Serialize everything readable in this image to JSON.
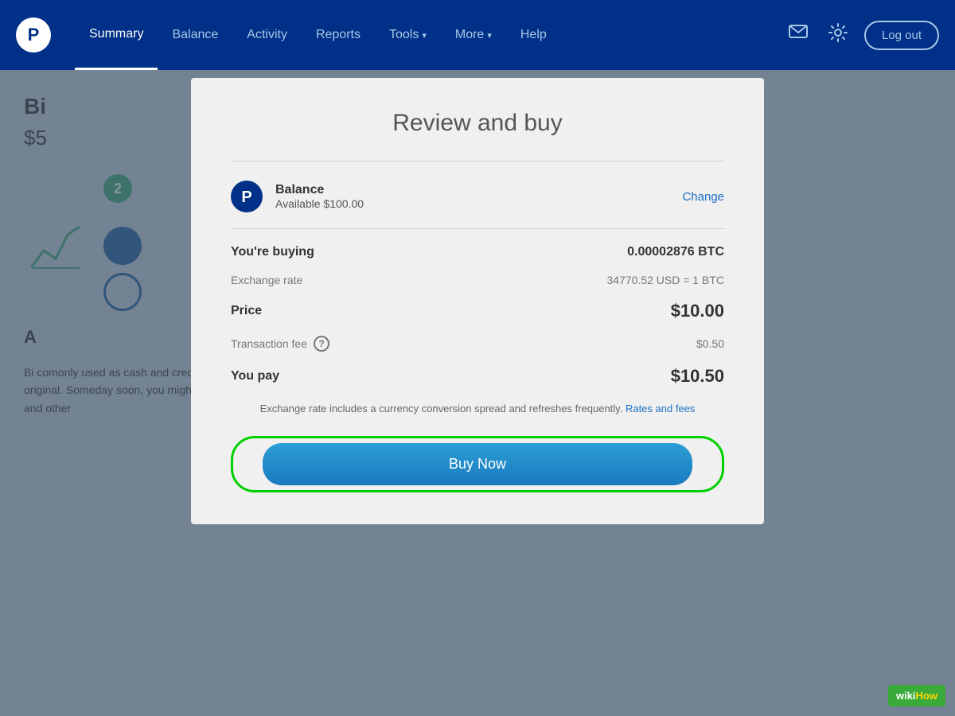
{
  "navbar": {
    "logo_alt": "PayPal",
    "links": [
      {
        "label": "Summary",
        "active": true
      },
      {
        "label": "Balance",
        "active": false
      },
      {
        "label": "Activity",
        "active": false
      },
      {
        "label": "Reports",
        "active": false
      },
      {
        "label": "Tools",
        "active": false,
        "has_chevron": true
      },
      {
        "label": "More",
        "active": false,
        "has_chevron": true
      },
      {
        "label": "Help",
        "active": false
      }
    ],
    "message_icon": "💬",
    "settings_icon": "⚙",
    "logout_label": "Log out"
  },
  "background": {
    "title": "Bi",
    "price": "$5",
    "step_number": "2",
    "section_heading": "A",
    "body_text": "Bi                                                                                                           comonly used as cash and credit. It set off a revolution that has since inspired thousands of variations on the original. Someday soon, you might be able to buy just about anything and send money to anyone using bitcoins and other"
  },
  "modal": {
    "title": "Review and buy",
    "payment": {
      "name": "Balance",
      "available": "Available $100.00",
      "change_label": "Change"
    },
    "buying_label": "You're buying",
    "buying_value": "0.00002876 BTC",
    "exchange_rate_label": "Exchange rate",
    "exchange_rate_value": "34770.52 USD = 1 BTC",
    "price_label": "Price",
    "price_value": "$10.00",
    "transaction_fee_label": "Transaction fee",
    "transaction_fee_value": "$0.50",
    "you_pay_label": "You pay",
    "you_pay_value": "$10.50",
    "note_text": "Exchange rate includes a currency conversion spread and refreshes frequently.",
    "rates_link_label": "Rates and fees",
    "buy_now_label": "Buy Now"
  },
  "wikihow": {
    "wiki": "wiki",
    "how": "How"
  }
}
